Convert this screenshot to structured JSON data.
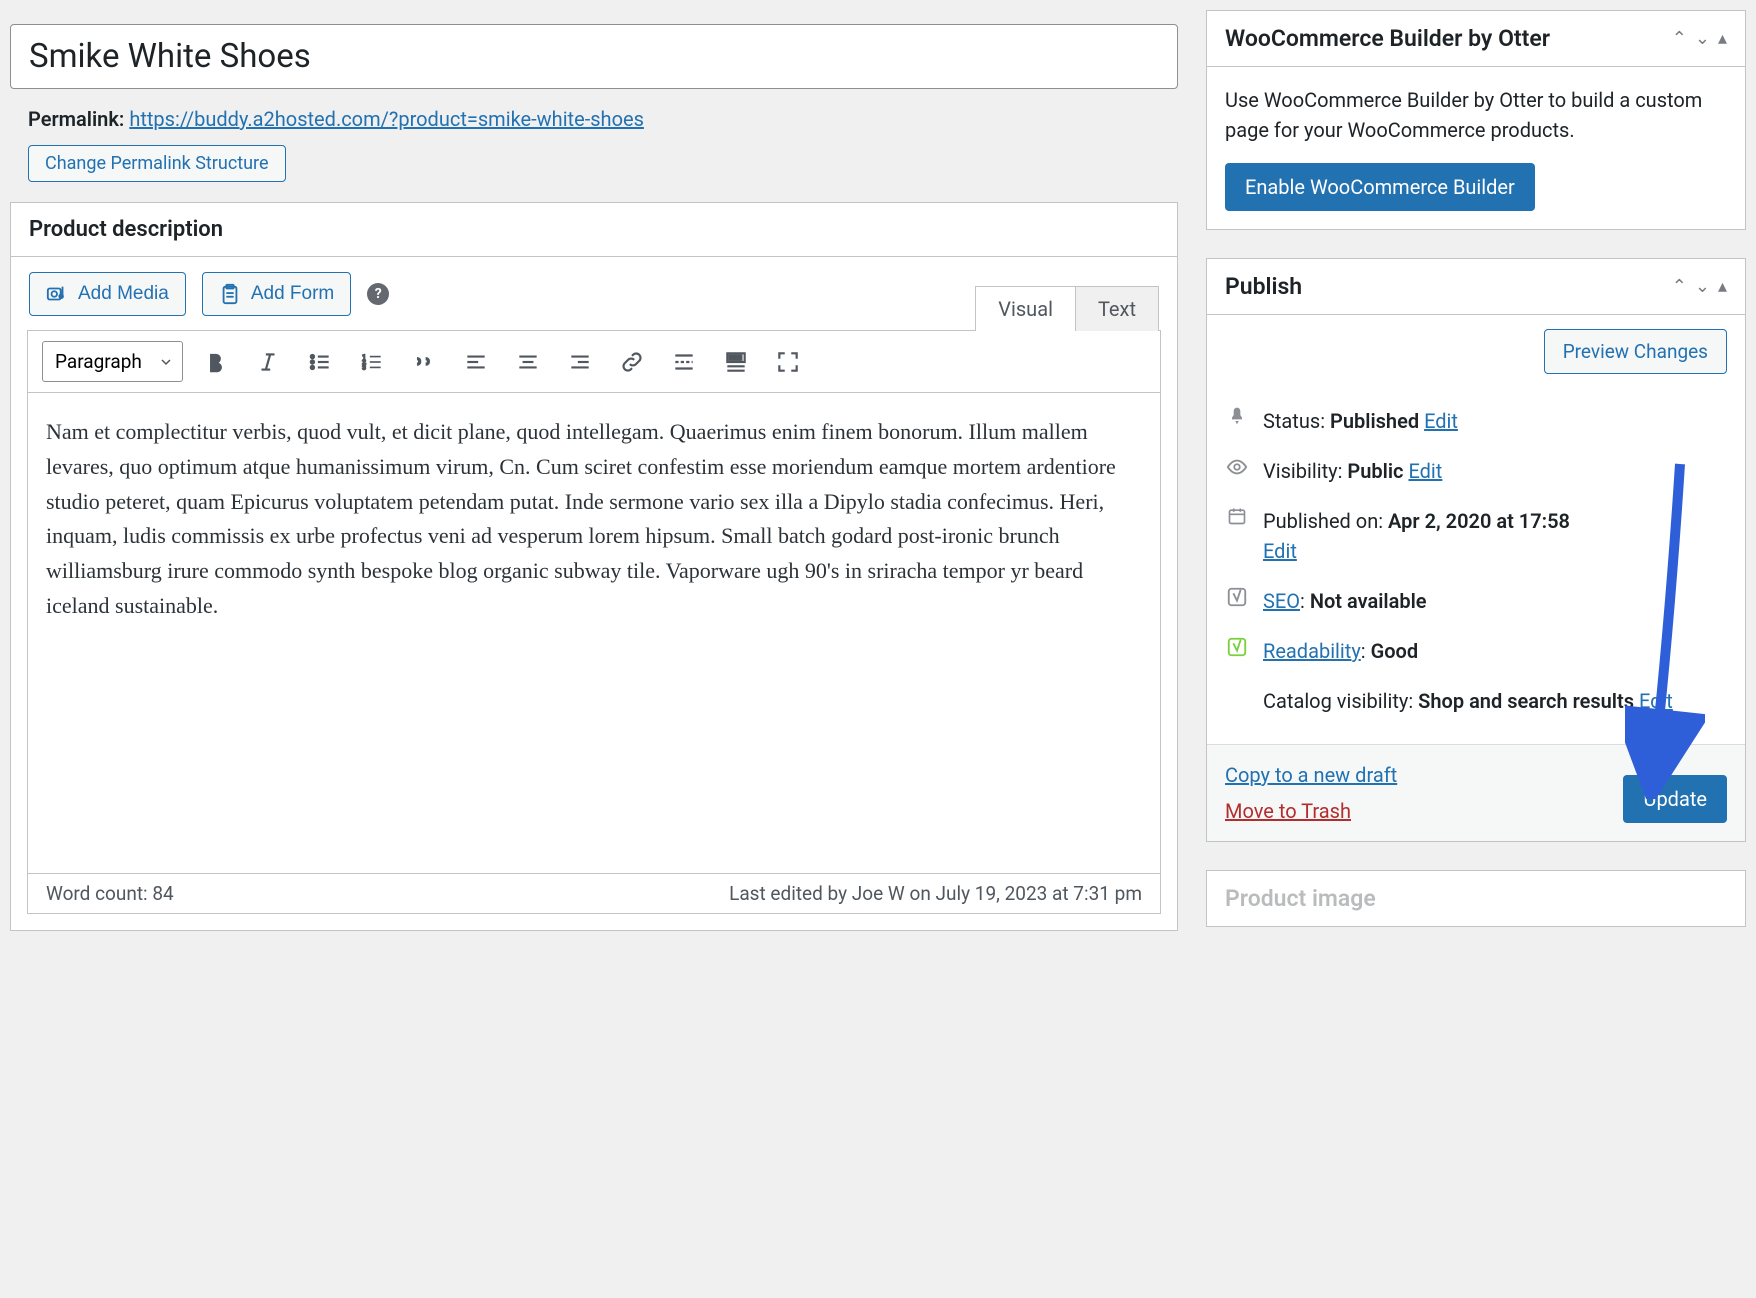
{
  "title": "Smike White Shoes",
  "permalink": {
    "label": "Permalink:",
    "url_text": "https://buddy.a2hosted.com/?product=smike-white-shoes",
    "change_btn": "Change Permalink Structure"
  },
  "editor": {
    "panel_title": "Product description",
    "add_media": "Add Media",
    "add_form": "Add Form",
    "tab_visual": "Visual",
    "tab_text": "Text",
    "format_sel": "Paragraph",
    "content": "Nam et complectitur verbis, quod vult, et dicit plane, quod intellegam. Quaerimus enim finem bonorum. Illum mallem levares, quo optimum atque humanissimum virum, Cn. Cum sciret confestim esse moriendum eamque mortem ardentiore studio peteret, quam Epicurus voluptatem petendam putat. Inde sermone vario sex illa a Dipylo stadia confecimus. Heri, inquam, ludis commissis ex urbe profectus veni ad vesperum lorem hipsum. Small batch godard post-ironic brunch williamsburg irure commodo synth bespoke blog organic subway tile. Vaporware ugh 90's in sriracha tempor yr beard iceland sustainable.",
    "word_count_label": "Word count: 84",
    "last_edited": "Last edited by Joe W on July 19, 2023 at 7:31 pm"
  },
  "otter": {
    "title": "WooCommerce Builder by Otter",
    "desc": "Use WooCommerce Builder by Otter to build a custom page for your WooCommerce products.",
    "btn": "Enable WooCommerce Builder"
  },
  "publish": {
    "title": "Publish",
    "preview_btn": "Preview Changes",
    "status_label": "Status:",
    "status_value": "Published",
    "visibility_label": "Visibility:",
    "visibility_value": "Public",
    "published_label": "Published on:",
    "published_value": "Apr 2, 2020 at 17:58",
    "seo_label": "SEO",
    "seo_value": "Not available",
    "readability_label": "Readability",
    "readability_value": "Good",
    "catalog_label": "Catalog visibility:",
    "catalog_value": "Shop and search results",
    "edit": "Edit",
    "copy_draft": "Copy to a new draft",
    "trash": "Move to Trash",
    "update": "Update"
  },
  "product_image_title": "Product image"
}
